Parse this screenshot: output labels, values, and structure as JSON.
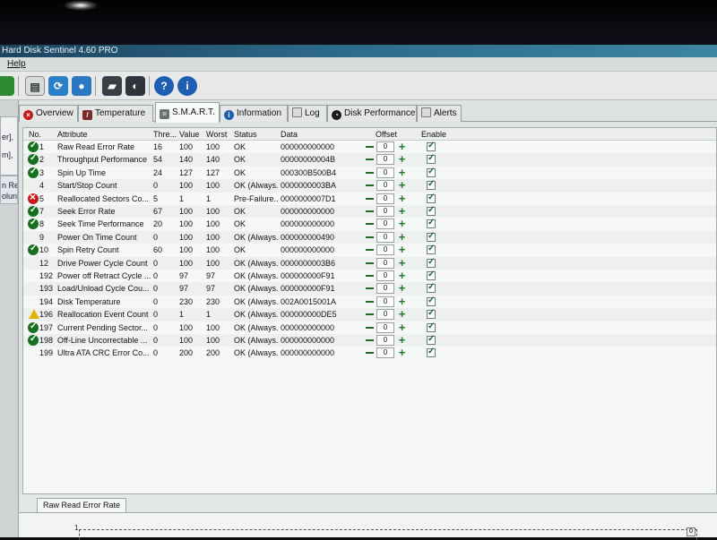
{
  "window": {
    "title": "Hard Disk Sentinel 4.60 PRO"
  },
  "menu": {
    "help": "Help"
  },
  "sidepane_fragments": [
    "er],",
    "m],",
    "n Re",
    "olun"
  ],
  "tabs": [
    {
      "label": "Overview",
      "icon": "error-icon"
    },
    {
      "label": "Temperature",
      "icon": "thermometer-icon"
    },
    {
      "label": "S.M.A.R.T.",
      "icon": "disk-icon",
      "active": true
    },
    {
      "label": "Information",
      "icon": "info-icon"
    },
    {
      "label": "Log",
      "icon": "log-icon"
    },
    {
      "label": "Disk Performance",
      "icon": "performance-icon"
    },
    {
      "label": "Alerts",
      "icon": "alerts-icon"
    }
  ],
  "smart": {
    "columns": {
      "no": "No.",
      "attribute": "Attribute",
      "threshold": "Thre...",
      "value": "Value",
      "worst": "Worst",
      "status": "Status",
      "data": "Data",
      "offset": "Offset",
      "enable": "Enable"
    },
    "rows": [
      {
        "icon": "ok",
        "no": "1",
        "attribute": "Raw Read Error Rate",
        "threshold": "16",
        "value": "100",
        "worst": "100",
        "status": "OK",
        "data": "000000000000",
        "offset": "0"
      },
      {
        "icon": "ok",
        "no": "2",
        "attribute": "Throughput Performance",
        "threshold": "54",
        "value": "140",
        "worst": "140",
        "status": "OK",
        "data": "00000000004B",
        "offset": "0"
      },
      {
        "icon": "ok",
        "no": "3",
        "attribute": "Spin Up Time",
        "threshold": "24",
        "value": "127",
        "worst": "127",
        "status": "OK",
        "data": "000300B500B4",
        "offset": "0"
      },
      {
        "icon": "none",
        "no": "4",
        "attribute": "Start/Stop Count",
        "threshold": "0",
        "value": "100",
        "worst": "100",
        "status": "OK (Always...",
        "data": "0000000003BA",
        "offset": "0"
      },
      {
        "icon": "bad",
        "no": "5",
        "attribute": "Reallocated Sectors Co...",
        "threshold": "5",
        "value": "1",
        "worst": "1",
        "status": "Pre-Failure...",
        "data": "0000000007D1",
        "offset": "0"
      },
      {
        "icon": "ok",
        "no": "7",
        "attribute": "Seek Error Rate",
        "threshold": "67",
        "value": "100",
        "worst": "100",
        "status": "OK",
        "data": "000000000000",
        "offset": "0"
      },
      {
        "icon": "ok",
        "no": "8",
        "attribute": "Seek Time Performance",
        "threshold": "20",
        "value": "100",
        "worst": "100",
        "status": "OK",
        "data": "000000000000",
        "offset": "0"
      },
      {
        "icon": "none",
        "no": "9",
        "attribute": "Power On Time Count",
        "threshold": "0",
        "value": "100",
        "worst": "100",
        "status": "OK (Always...",
        "data": "000000000490",
        "offset": "0"
      },
      {
        "icon": "ok",
        "no": "10",
        "attribute": "Spin Retry Count",
        "threshold": "60",
        "value": "100",
        "worst": "100",
        "status": "OK",
        "data": "000000000000",
        "offset": "0"
      },
      {
        "icon": "none",
        "no": "12",
        "attribute": "Drive Power Cycle Count",
        "threshold": "0",
        "value": "100",
        "worst": "100",
        "status": "OK (Always...",
        "data": "0000000003B6",
        "offset": "0"
      },
      {
        "icon": "none",
        "no": "192",
        "attribute": "Power off Retract Cycle ...",
        "threshold": "0",
        "value": "97",
        "worst": "97",
        "status": "OK (Always...",
        "data": "000000000F91",
        "offset": "0"
      },
      {
        "icon": "none",
        "no": "193",
        "attribute": "Load/Unload Cycle Cou...",
        "threshold": "0",
        "value": "97",
        "worst": "97",
        "status": "OK (Always...",
        "data": "000000000F91",
        "offset": "0"
      },
      {
        "icon": "none",
        "no": "194",
        "attribute": "Disk Temperature",
        "threshold": "0",
        "value": "230",
        "worst": "230",
        "status": "OK (Always...",
        "data": "002A0015001A",
        "offset": "0"
      },
      {
        "icon": "warn",
        "no": "196",
        "attribute": "Reallocation Event Count",
        "threshold": "0",
        "value": "1",
        "worst": "1",
        "status": "OK (Always...",
        "data": "000000000DE5",
        "offset": "0"
      },
      {
        "icon": "ok",
        "no": "197",
        "attribute": "Current Pending Sector...",
        "threshold": "0",
        "value": "100",
        "worst": "100",
        "status": "OK (Always...",
        "data": "000000000000",
        "offset": "0"
      },
      {
        "icon": "ok",
        "no": "198",
        "attribute": "Off-Line Uncorrectable ...",
        "threshold": "0",
        "value": "100",
        "worst": "100",
        "status": "OK (Always...",
        "data": "000000000000",
        "offset": "0"
      },
      {
        "icon": "none",
        "no": "199",
        "attribute": "Ultra ATA CRC Error Co...",
        "threshold": "0",
        "value": "200",
        "worst": "200",
        "status": "OK (Always...",
        "data": "000000000000",
        "offset": "0"
      }
    ]
  },
  "graph": {
    "tab_label": "Raw Read Error Rate",
    "y_tick": "1",
    "zoom_label": "0"
  }
}
